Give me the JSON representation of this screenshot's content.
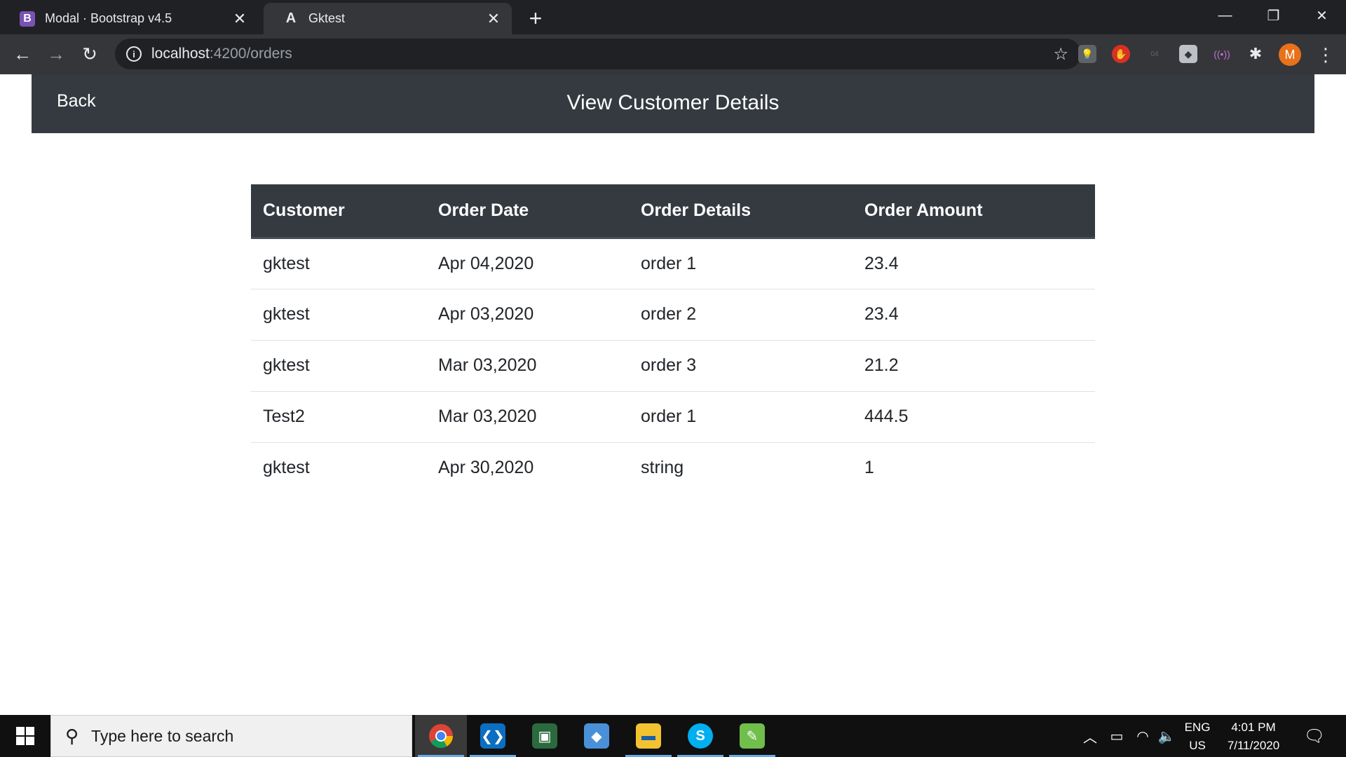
{
  "browser": {
    "tabs": [
      {
        "favicon": "B",
        "title": "Modal · Bootstrap v4.5",
        "close": "✕"
      },
      {
        "favicon": "A",
        "title": "Gktest",
        "close": "✕"
      }
    ],
    "new_tab": "+",
    "window_controls": {
      "minimize": "—",
      "restore": "❐",
      "close": "✕"
    },
    "url_host": "localhost",
    "url_path": ":4200/orders",
    "nav": {
      "back": "←",
      "forward": "→",
      "reload": "↻"
    },
    "star": "☆",
    "profile_initial": "M",
    "menu": "⋮"
  },
  "app": {
    "back_label": "Back",
    "title": "View Customer Details",
    "table": {
      "headers": [
        "Customer",
        "Order Date",
        "Order Details",
        "Order Amount"
      ],
      "rows": [
        [
          "gktest",
          "Apr 04,2020",
          "order 1",
          "23.4"
        ],
        [
          "gktest",
          "Apr 03,2020",
          "order 2",
          "23.4"
        ],
        [
          "gktest",
          "Mar 03,2020",
          "order 3",
          "21.2"
        ],
        [
          "Test2",
          "Mar 03,2020",
          "order 1",
          "444.5"
        ],
        [
          "gktest",
          "Apr 30,2020",
          "string",
          "1"
        ]
      ]
    }
  },
  "taskbar": {
    "search_placeholder": "Type here to search",
    "apps": [
      "chrome-icon",
      "vscode-icon",
      "security-tool-icon",
      "box-app-icon",
      "file-explorer-icon",
      "skype-icon",
      "notepad-icon"
    ],
    "lang_top": "ENG",
    "lang_bottom": "US",
    "time": "4:01 PM",
    "date": "7/11/2020"
  },
  "colors": {
    "navbar_bg": "#343a40",
    "browser_dark": "#202124",
    "browser_toolbar": "#35363a",
    "taskbar": "#101010"
  }
}
